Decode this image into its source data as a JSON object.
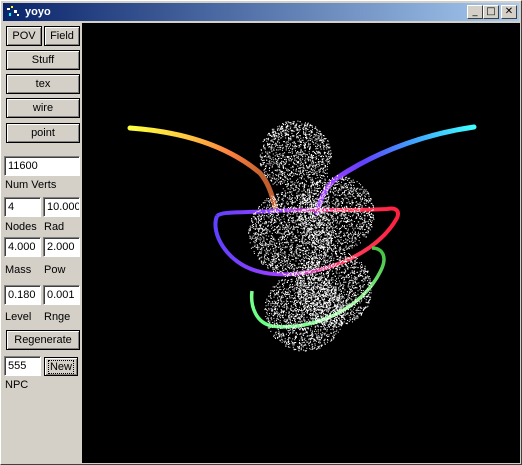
{
  "window": {
    "title": "yoyo"
  },
  "title_buttons": {
    "minimize": "_",
    "maximize": "□",
    "close": "✕"
  },
  "toolbar": {
    "pov": "POV",
    "field": "Field",
    "stuff": "Stuff",
    "tex": "tex",
    "wire": "wire",
    "point": "point"
  },
  "params": {
    "num_verts_value": "11600",
    "num_verts_label": "Num Verts",
    "nodes_value": "4",
    "rad_value": "10.000",
    "nodes_label": "Nodes",
    "rad_label": "Rad",
    "mass_value": "4.000",
    "pow_value": "2.000",
    "mass_label": "Mass",
    "pow_label": "Pow",
    "level_value": "0.180",
    "rnge_value": "0.001",
    "level_label": "Level",
    "rnge_label": "Rnge",
    "regenerate": "Regenerate",
    "npc_value": "555",
    "new": "New",
    "npc_label": "NPC"
  },
  "viewport": {
    "background": "#000000"
  },
  "colors": {
    "titlebar_start": "#0a246a",
    "titlebar_end": "#a6caf0",
    "face": "#d4d0c8"
  }
}
